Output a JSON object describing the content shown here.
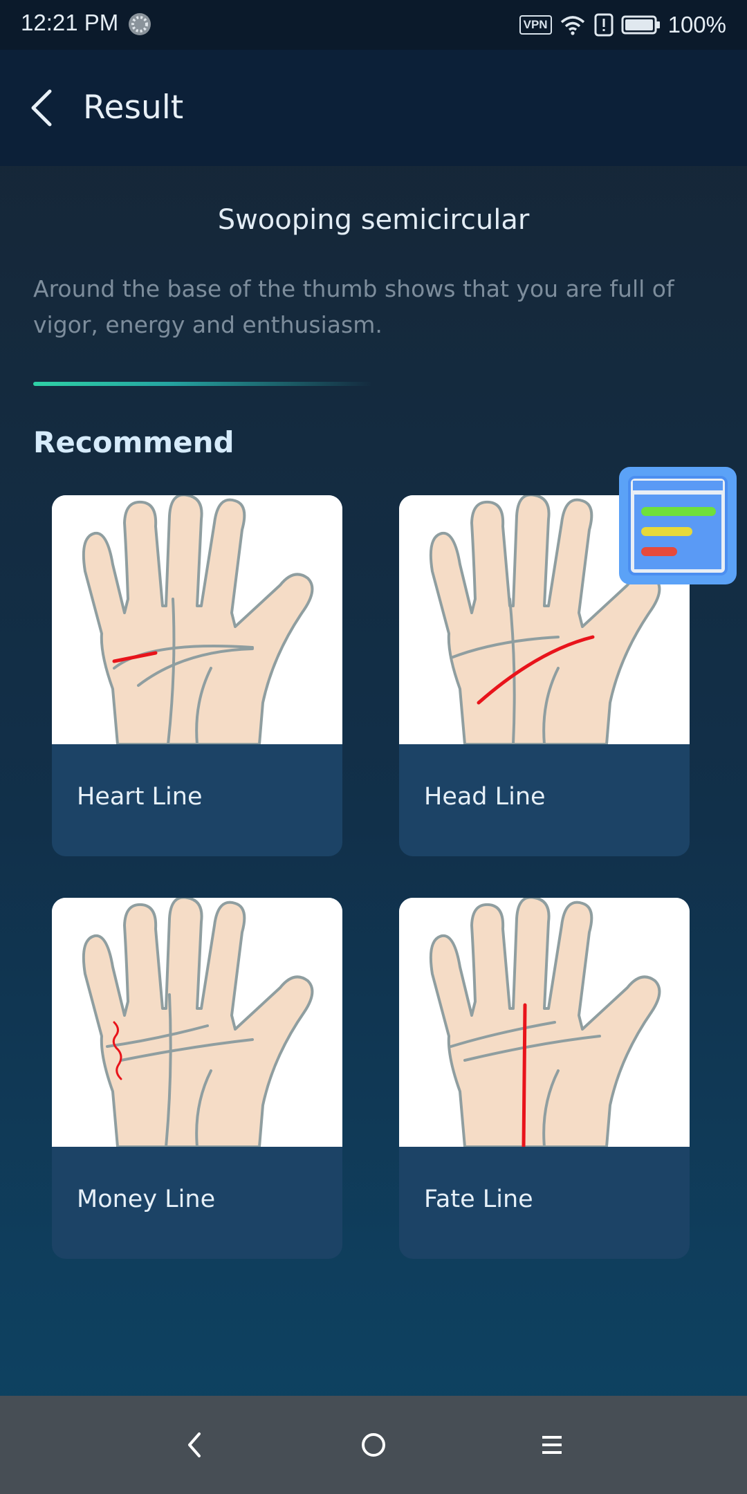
{
  "status_bar": {
    "time": "12:21 PM",
    "vpn": "VPN",
    "battery": "100%"
  },
  "app_bar": {
    "title": "Result"
  },
  "result": {
    "headline": "Swooping semicircular",
    "description": "Around the base of the thumb shows that you are full of vigor, energy and enthusiasm."
  },
  "recommend": {
    "title": "Recommend",
    "cards": [
      {
        "label": "Heart Line"
      },
      {
        "label": "Head Line"
      },
      {
        "label": "Money Line"
      },
      {
        "label": "Fate Line"
      }
    ]
  },
  "colors": {
    "accent_divider": "#2fd1a6",
    "highlight_line": "#e8141b",
    "card_background": "#1c4366",
    "skin": "#f5dcc6"
  },
  "icons": [
    "back-icon",
    "spinner-icon",
    "wifi-icon",
    "alert-icon",
    "battery-icon",
    "nav-back-icon",
    "nav-home-icon",
    "nav-menu-icon"
  ]
}
